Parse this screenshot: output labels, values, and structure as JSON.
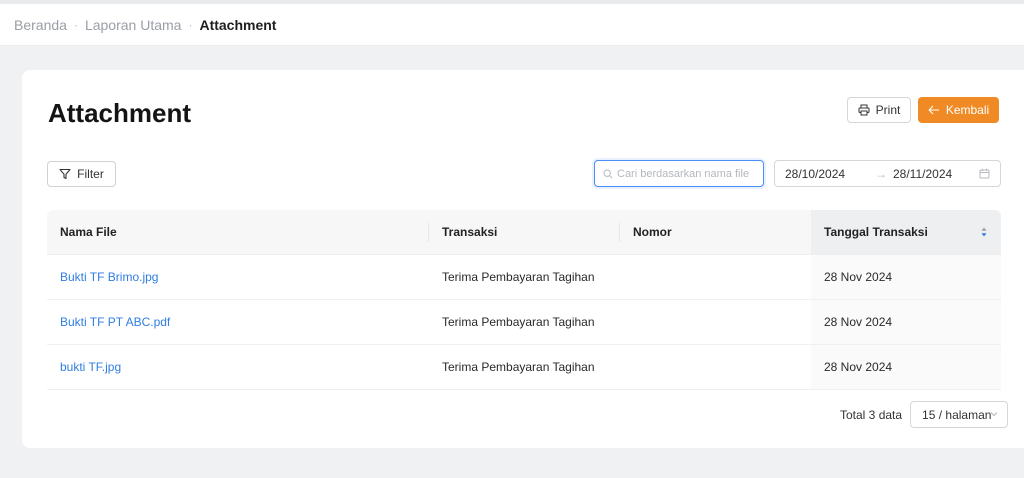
{
  "breadcrumb": {
    "items": [
      "Beranda",
      "Laporan Utama"
    ],
    "current": "Attachment",
    "separator": "·"
  },
  "page": {
    "title": "Attachment"
  },
  "actions": {
    "print_label": "Print",
    "print_icon": "printer-icon",
    "back_label": "Kembali",
    "back_icon": "arrow-left-icon"
  },
  "filter": {
    "label": "Filter",
    "icon": "filter-icon"
  },
  "search": {
    "placeholder": "Cari berdasarkan nama file",
    "value": "",
    "icon": "search-icon"
  },
  "date_range": {
    "start": "28/10/2024",
    "end": "28/11/2024",
    "arrow": "→",
    "icon": "calendar-icon"
  },
  "table": {
    "columns": [
      "Nama File",
      "Transaksi",
      "Nomor",
      "Tanggal Transaksi"
    ],
    "sorted_column": "Tanggal Transaksi",
    "rows": [
      {
        "file": "Bukti TF Brimo.jpg",
        "transaksi": "Terima Pembayaran Tagihan",
        "nomor": "",
        "tanggal": "28 Nov 2024"
      },
      {
        "file": "Bukti TF PT ABC.pdf",
        "transaksi": "Terima Pembayaran Tagihan",
        "nomor": "",
        "tanggal": "28 Nov 2024"
      },
      {
        "file": "bukti TF.jpg",
        "transaksi": "Terima Pembayaran Tagihan",
        "nomor": "",
        "tanggal": "28 Nov 2024"
      }
    ]
  },
  "pagination": {
    "total_label": "Total 3 data",
    "page_size": "15 / halaman"
  },
  "colors": {
    "accent": "#f08a24",
    "link": "#2f7de1",
    "focus": "#4a8ff5"
  }
}
